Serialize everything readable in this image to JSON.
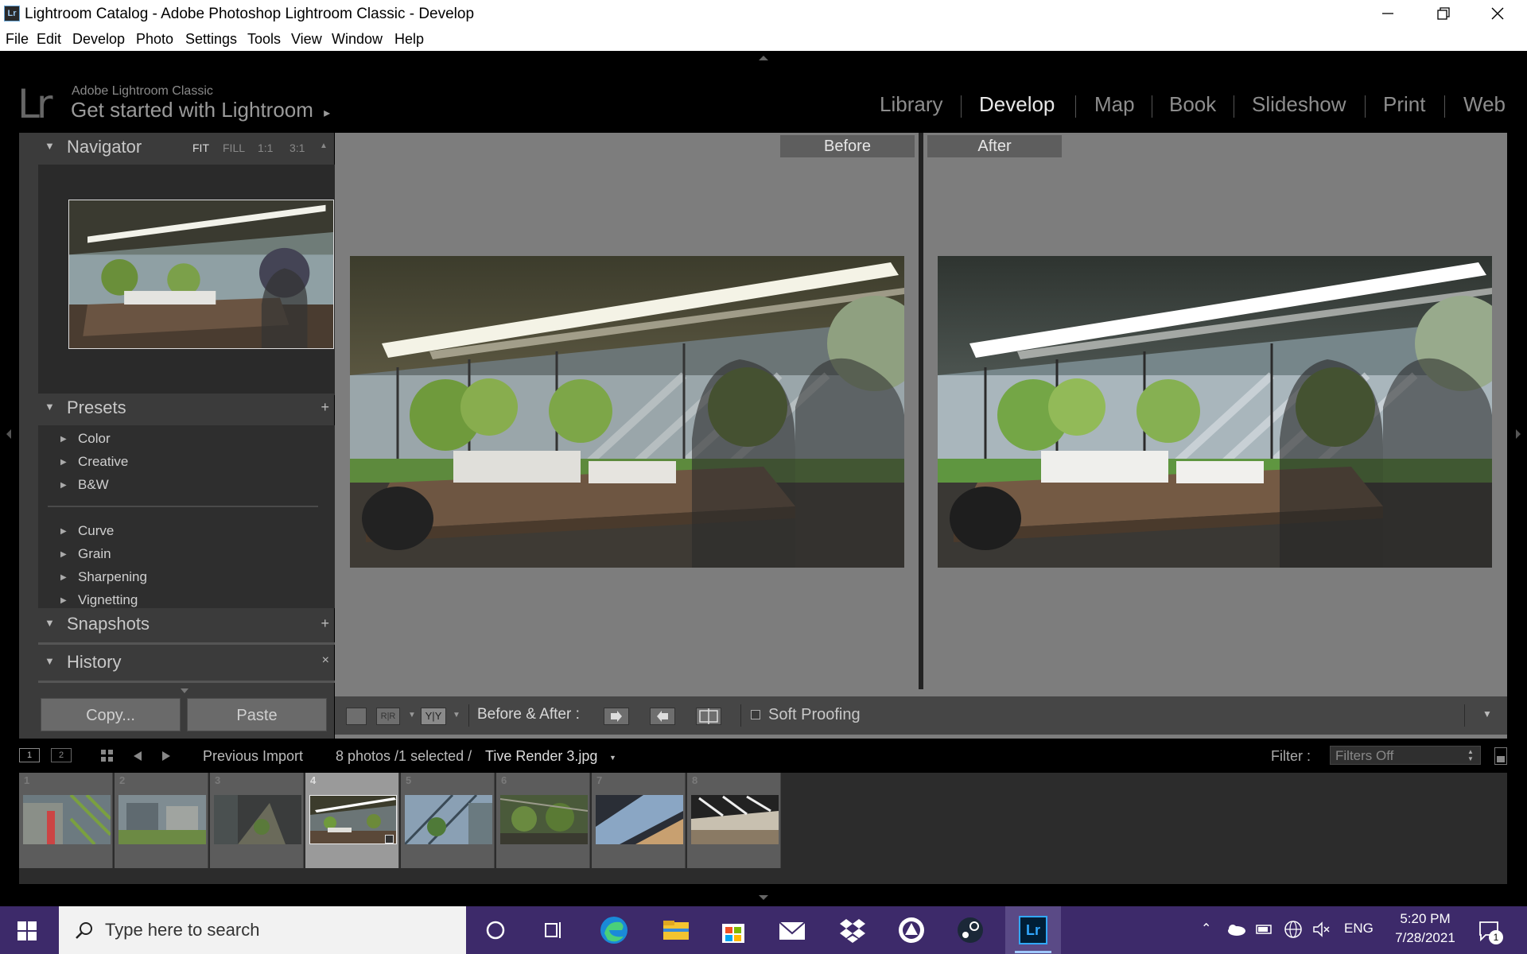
{
  "window": {
    "app_icon": "Lr",
    "title": "Lightroom Catalog - Adobe Photoshop Lightroom Classic - Develop"
  },
  "menu": [
    "File",
    "Edit",
    "Develop",
    "Photo",
    "Settings",
    "Tools",
    "View",
    "Window",
    "Help"
  ],
  "identity": {
    "logo": "Lr",
    "small": "Adobe Lightroom Classic",
    "big": "Get started with Lightroom",
    "big_arrow": "▸"
  },
  "modules": [
    "Library",
    "Develop",
    "Map",
    "Book",
    "Slideshow",
    "Print",
    "Web"
  ],
  "active_module": "Develop",
  "navigator": {
    "title": "Navigator",
    "options": [
      "FIT",
      "FILL",
      "1:1",
      "3:1"
    ],
    "active_option": "FIT"
  },
  "presets": {
    "title": "Presets",
    "group1": [
      "Color",
      "Creative",
      "B&W"
    ],
    "group2": [
      "Curve",
      "Grain",
      "Sharpening",
      "Vignetting"
    ]
  },
  "snapshots": {
    "title": "Snapshots"
  },
  "history": {
    "title": "History"
  },
  "buttons": {
    "copy": "Copy...",
    "paste": "Paste"
  },
  "view": {
    "before_label": "Before",
    "after_label": "After"
  },
  "toolbar": {
    "before_after_label": "Before & After :",
    "yy_label": "Y|Y",
    "soft_proofing": "Soft Proofing",
    "soft_proofing_checked": false
  },
  "filmhead": {
    "source": "Previous Import",
    "count_text": "8 photos /1 selected /",
    "filename": "Tive Render 3.jpg",
    "filter_label": "Filter :",
    "filter_value": "Filters Off"
  },
  "filmstrip": {
    "numbers": [
      "1",
      "2",
      "3",
      "4",
      "5",
      "6",
      "7",
      "8"
    ],
    "selected_index": 4
  },
  "taskbar": {
    "search_placeholder": "Type here to search",
    "lang": "ENG",
    "time": "5:20 PM",
    "date": "7/28/2021",
    "notifications": "1"
  },
  "colors": {
    "panel": "#3b3b3b",
    "main_bg": "#7d7d7d",
    "taskbar": "#3d2a6a",
    "active_module": "#e8e8e8"
  }
}
